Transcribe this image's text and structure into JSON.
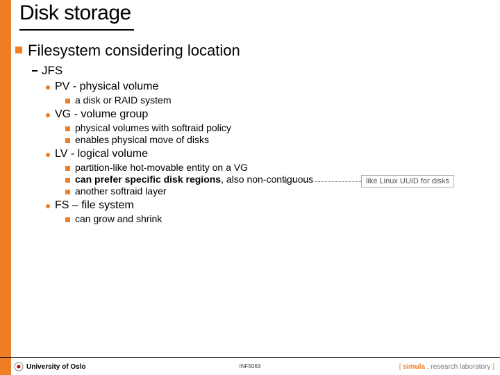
{
  "title": "Disk storage",
  "heading": "Filesystem considering location",
  "sub": "JFS",
  "items": {
    "pv": {
      "label": "PV - physical volume",
      "sub1": "a disk or RAID system"
    },
    "vg": {
      "label": "VG - volume group",
      "sub1": "physical volumes with softraid policy",
      "sub2": "enables physical move of disks"
    },
    "lv": {
      "label": "LV - logical volume",
      "sub1": "partition-like hot-movable entity on a VG",
      "sub2a": "can prefer specific disk regions",
      "sub2b": ", also non-contiguous",
      "sub3": "another softraid layer"
    },
    "fs": {
      "label": "FS – file system",
      "sub1": "can grow and shrink"
    }
  },
  "callout": "like Linux UUID for disks",
  "footer": {
    "left": "University of Oslo",
    "center": "INF5063",
    "right_bracket_l": "[ ",
    "right_brand": "simula",
    "right_dot": " . ",
    "right_rest": "research laboratory",
    "right_bracket_r": " ]"
  }
}
